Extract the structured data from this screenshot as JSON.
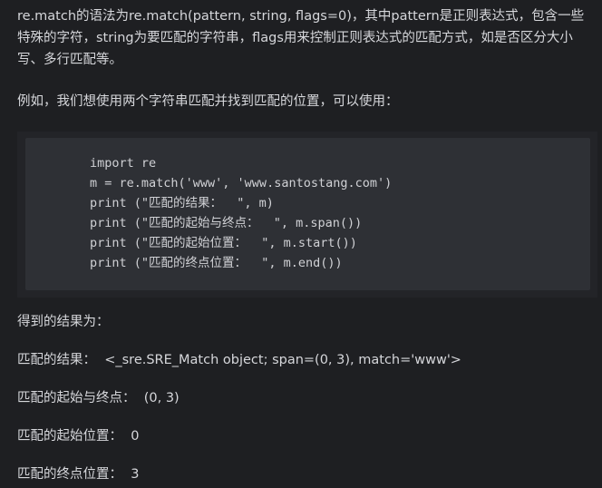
{
  "paragraphs": [
    "re.match的语法为re.match(pattern, string, flags=0)，其中pattern是正则表达式，包含一些特殊的字符，string为要匹配的字符串，flags用来控制正则表达式的匹配方式，如是否区分大小写、多行匹配等。",
    "例如，我们想使用两个字符串匹配并找到匹配的位置，可以使用："
  ],
  "code": {
    "language": "python",
    "lines": [
      "import re",
      "m = re.match('www', 'www.santostang.com')",
      "print (\"匹配的结果：  \", m)",
      "print (\"匹配的起始与终点：  \", m.span())",
      "print (\"匹配的起始位置：  \", m.start())",
      "print (\"匹配的终点位置：  \", m.end())"
    ]
  },
  "results": [
    "得到的结果为：",
    "匹配的结果：  <_sre.SRE_Match object; span=(0, 3), match='www'>",
    "匹配的起始与终点：  (0, 3)",
    "匹配的起始位置：  0",
    "匹配的终点位置：  3"
  ],
  "colors": {
    "background": "#1e1f22",
    "code_outer": "#232428",
    "code_inner": "#2e3035",
    "text": "#d6d7db"
  }
}
